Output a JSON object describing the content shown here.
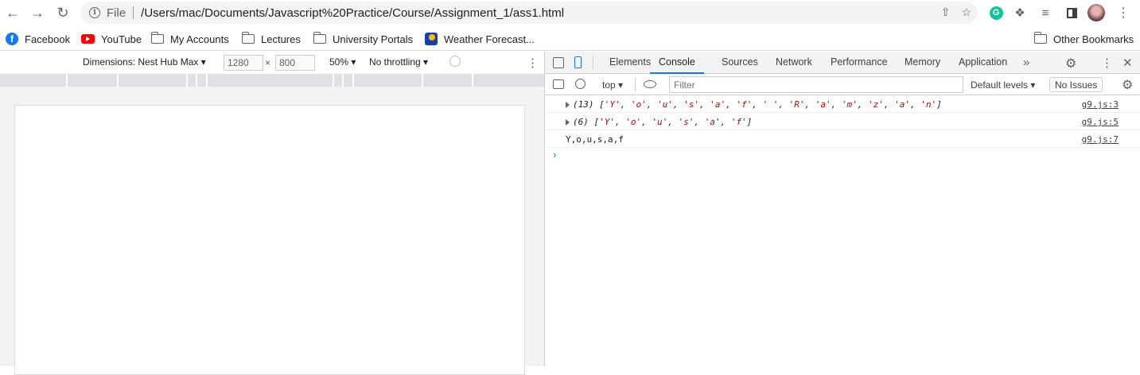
{
  "browser": {
    "omnibox": {
      "scheme": "File",
      "url": "/Users/mac/Documents/Javascript%20Practice/Course/Assignment_1/ass1.html"
    }
  },
  "bookmarks": [
    {
      "label": "Facebook",
      "icon": "facebook-icon"
    },
    {
      "label": "YouTube",
      "icon": "youtube-icon"
    },
    {
      "label": "My Accounts",
      "icon": "folder-icon"
    },
    {
      "label": "Lectures",
      "icon": "folder-icon"
    },
    {
      "label": "University Portals",
      "icon": "folder-icon"
    },
    {
      "label": "Weather Forecast...",
      "icon": "weather-icon"
    }
  ],
  "other_bookmarks": "Other Bookmarks",
  "device_toolbar": {
    "dimensions_label": "Dimensions: Nest Hub Max",
    "width": "1280",
    "times": "×",
    "height": "800",
    "zoom": "50%",
    "throttling": "No throttling"
  },
  "devtools": {
    "tabs": [
      "Elements",
      "Console",
      "Sources",
      "Network",
      "Performance",
      "Memory",
      "Application"
    ],
    "active_tab": "Console",
    "more": "»",
    "context": "top",
    "filter_placeholder": "Filter",
    "levels": "Default levels",
    "issues": "No Issues"
  },
  "console": {
    "logs": [
      {
        "count": "(13)",
        "items": [
          "Y",
          "o",
          "u",
          "s",
          "a",
          "f",
          " ",
          "R",
          "a",
          "m",
          "z",
          "a",
          "n"
        ],
        "source": "g9.js:3"
      },
      {
        "count": "(6)",
        "items": [
          "Y",
          "o",
          "u",
          "s",
          "a",
          "f"
        ],
        "source": "g9.js:5"
      },
      {
        "text": "Y,o,u,s,a,f",
        "source": "g9.js:7"
      }
    ],
    "prompt": "›"
  },
  "colors": {
    "accent": "#1a73e8",
    "string": "#c80000"
  }
}
